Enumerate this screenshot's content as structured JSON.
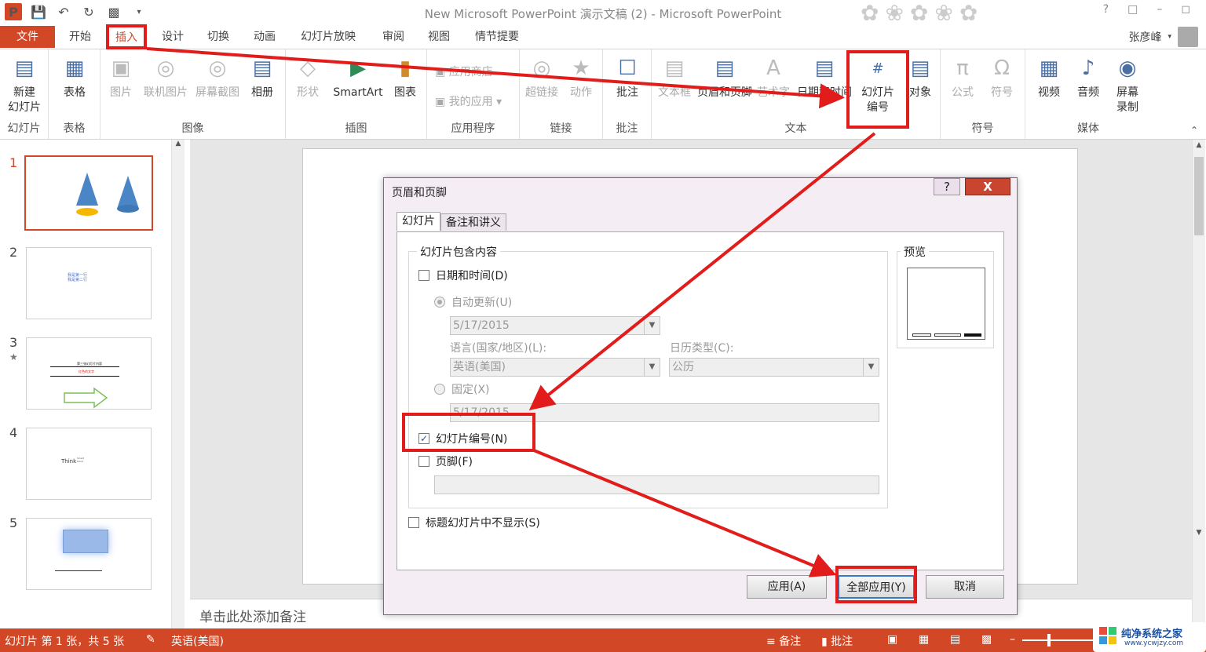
{
  "window": {
    "title": "New Microsoft PowerPoint 演示文稿 (2) - Microsoft PowerPoint",
    "user": "张彦峰"
  },
  "tabs": [
    "文件",
    "开始",
    "插入",
    "设计",
    "切换",
    "动画",
    "幻灯片放映",
    "审阅",
    "视图",
    "情节提要"
  ],
  "ribbon": {
    "groups": [
      "幻灯片",
      "表格",
      "图像",
      "插图",
      "应用程序",
      "链接",
      "批注",
      "文本",
      "符号",
      "媒体"
    ],
    "new_slide": [
      "新建",
      "幻灯片"
    ],
    "table": "表格",
    "picture": "图片",
    "online_picture": "联机图片",
    "screenshot": "屏幕截图",
    "album": "相册",
    "shapes": "形状",
    "smartart": "SmartArt",
    "chart": "图表",
    "app_store": "应用商店",
    "my_apps": "我的应用",
    "hyperlink": "超链接",
    "action": "动作",
    "comment": "批注",
    "textbox": "文本框",
    "header_footer": "页眉和页脚",
    "wordart": "艺术字",
    "datetime": "日期和时间",
    "slide_number": [
      "幻灯片",
      "编号"
    ],
    "object": "对象",
    "equation": "公式",
    "symbol": "符号",
    "video": "视频",
    "audio": "音频",
    "screen_record": [
      "屏幕",
      "录制"
    ]
  },
  "thumbnails": [
    "1",
    "2",
    "3",
    "4",
    "5"
  ],
  "thumb_texts": {
    "t2": "我是第一行\n我是第二行",
    "t3a": "第三张幻灯片内容",
    "t3b": "红色的文字",
    "t4a": "Think",
    "t4b": "Smart\nGood"
  },
  "notes_placeholder": "单击此处添加备注",
  "status": {
    "slide_info": "幻灯片 第 1 张，共 5 张",
    "language": "英语(美国)",
    "notes": "备注",
    "comments": "批注"
  },
  "watermark": {
    "name": "纯净系统之家",
    "url": "www.ycwjzy.com"
  },
  "dialog": {
    "title": "页眉和页脚",
    "help": "?",
    "close": "X",
    "tab_slide": "幻灯片",
    "tab_notes": "备注和讲义",
    "legend": "幻灯片包含内容",
    "datetime_label": "日期和时间(D)",
    "auto_update_label": "自动更新(U)",
    "date_value": "5/17/2015",
    "language_label": "语言(国家/地区)(L):",
    "language_value": "英语(美国)",
    "calendar_label": "日历类型(C):",
    "calendar_value": "公历",
    "fixed_label": "固定(X)",
    "fixed_value": "5/17/2015",
    "slide_number_label": "幻灯片编号(N)",
    "footer_label": "页脚(F)",
    "no_title_label": "标题幻灯片中不显示(S)",
    "preview_label": "预览",
    "apply_btn": "应用(A)",
    "apply_all_btn": "全部应用(Y)",
    "cancel_btn": "取消"
  },
  "colors": {
    "accent": "#d24726",
    "highlight": "#e21b1b"
  }
}
